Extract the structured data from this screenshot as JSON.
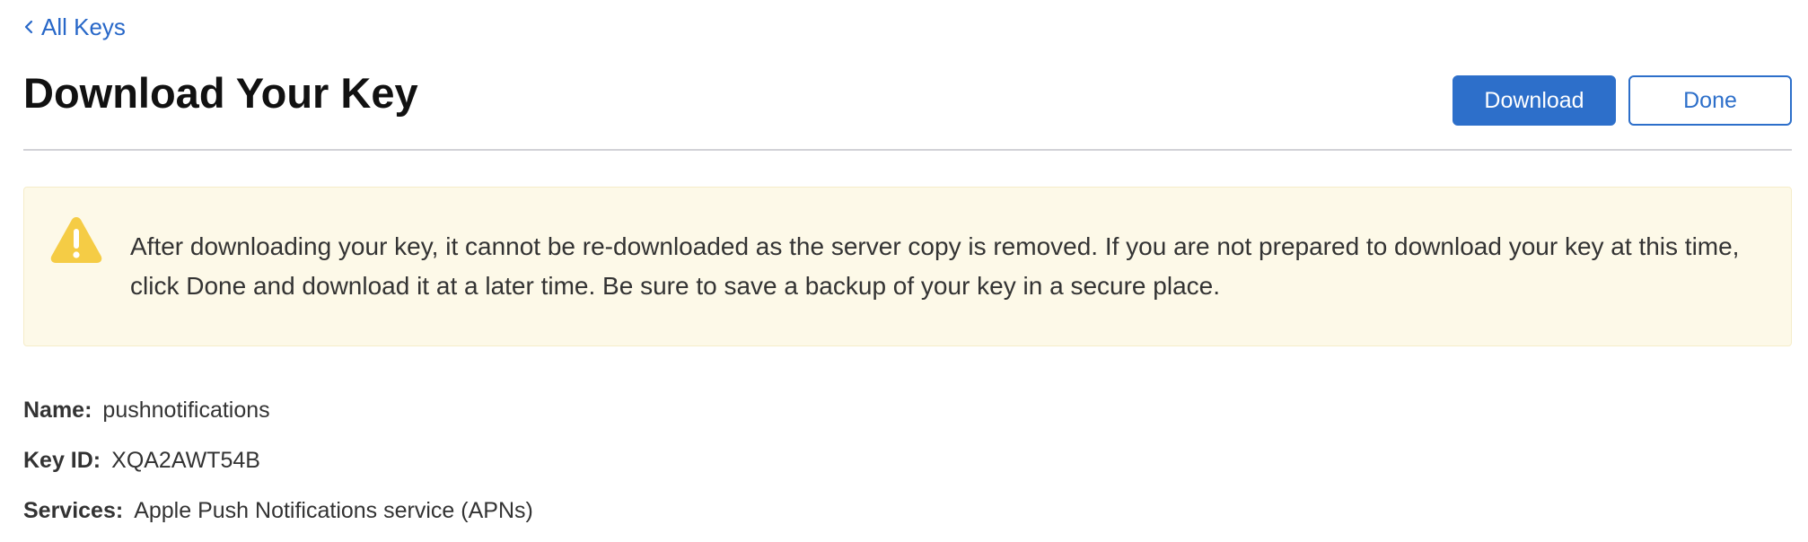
{
  "nav": {
    "back_label": "All Keys"
  },
  "header": {
    "title": "Download Your Key",
    "download_label": "Download",
    "done_label": "Done"
  },
  "warning": {
    "icon": "warning-triangle-icon",
    "message": "After downloading your key, it cannot be re-downloaded as the server copy is removed. If you are not prepared to download your key at this time, click Done and download it at a later time. Be sure to save a backup of your key in a secure place."
  },
  "details": {
    "name_label": "Name:",
    "name_value": "pushnotifications",
    "keyid_label": "Key ID:",
    "keyid_value": "XQA2AWT54B",
    "services_label": "Services:",
    "services_value": "Apple Push Notifications service (APNs)"
  },
  "colors": {
    "accent": "#2d6fca",
    "link": "#2767c8",
    "warning_bg": "#fdf9e8",
    "warning_icon": "#f5cc45"
  }
}
